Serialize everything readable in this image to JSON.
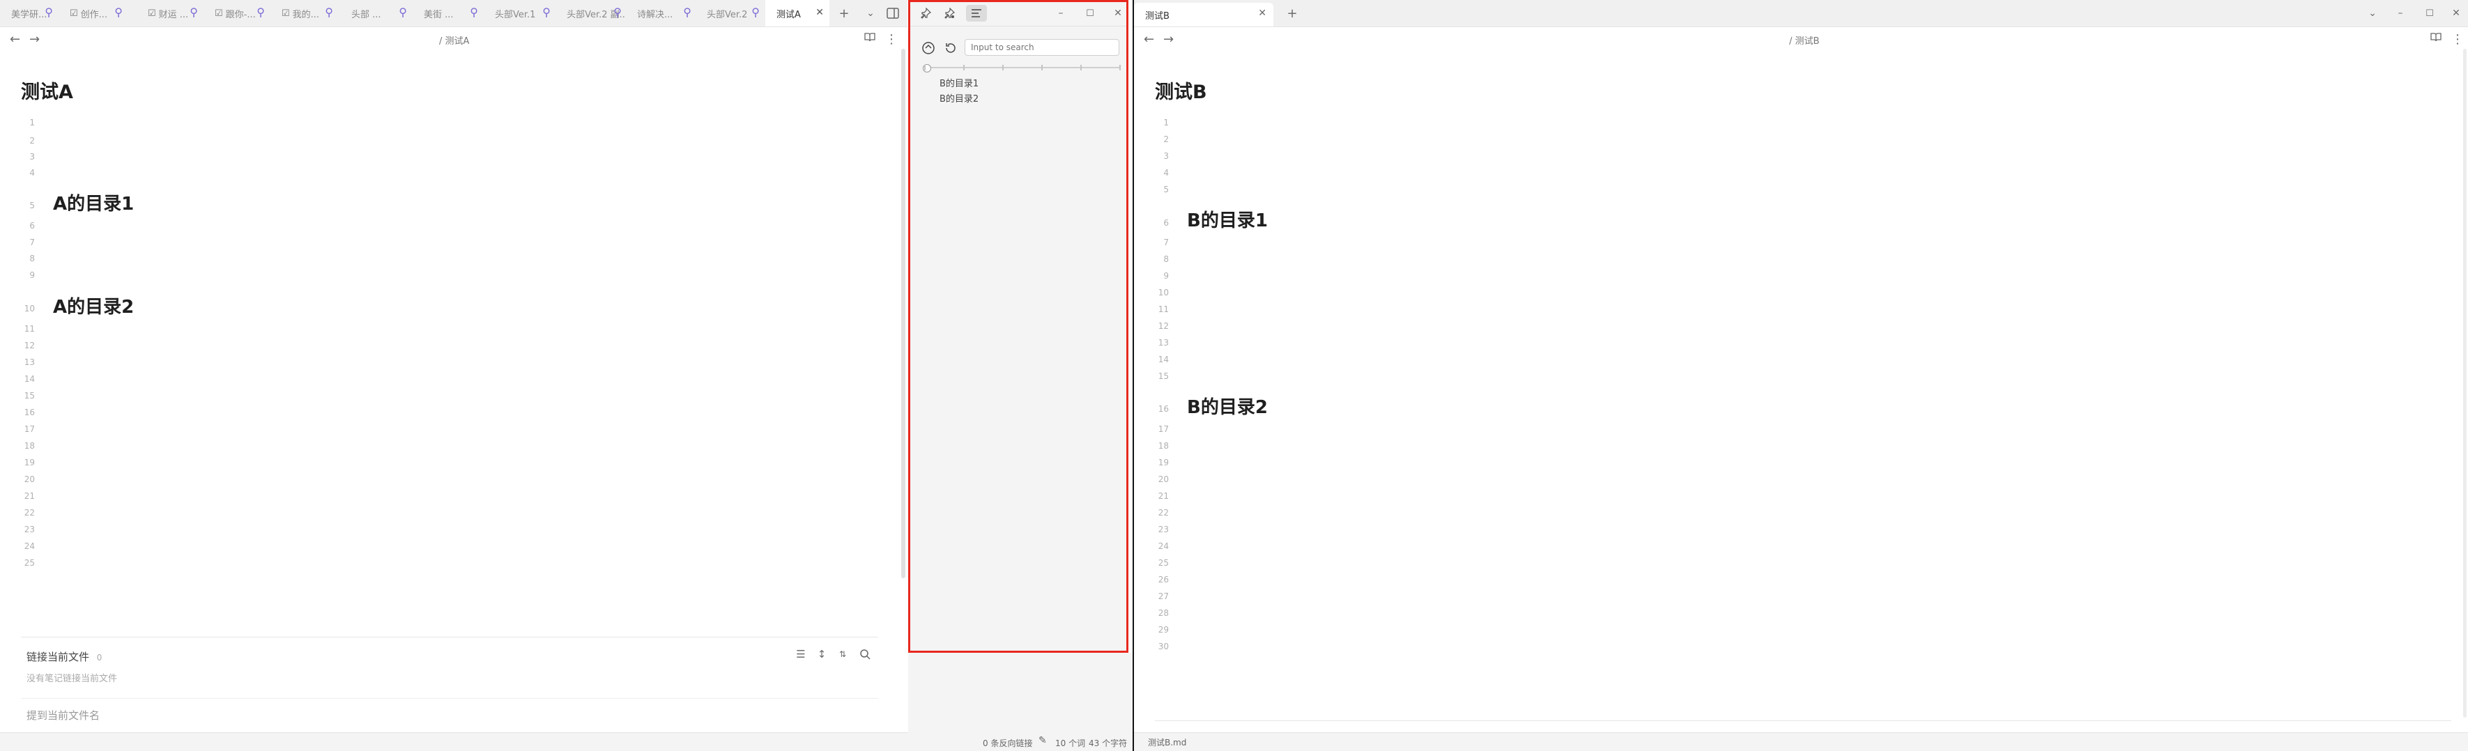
{
  "left_window": {
    "tabs": [
      {
        "label": "美学研...",
        "pinned": true,
        "checkbox": false
      },
      {
        "label": "创作...",
        "pinned": true,
        "checkbox": true
      },
      {
        "label": "财运 ...",
        "pinned": true,
        "checkbox": true
      },
      {
        "label": "跟你-...",
        "pinned": true,
        "checkbox": true
      },
      {
        "label": "我的...",
        "pinned": true,
        "checkbox": true
      },
      {
        "label": "头部 ...",
        "pinned": true,
        "checkbox": false
      },
      {
        "label": "美街 ...",
        "pinned": true,
        "checkbox": false
      },
      {
        "label": "头部Ver.1",
        "pinned": true,
        "checkbox": false
      },
      {
        "label": "头部Ver.2 副...",
        "pinned": true,
        "checkbox": false
      },
      {
        "label": "诗解决...",
        "pinned": true,
        "checkbox": false
      },
      {
        "label": "头部Ver.2",
        "pinned": true,
        "checkbox": false
      },
      {
        "label": "测试A",
        "pinned": false,
        "checkbox": false,
        "active": true
      }
    ],
    "breadcrumb": "/ 测试A",
    "title": "测试A",
    "headings": [
      "A的目录1",
      "A的目录2"
    ],
    "line_numbers": [
      "1",
      "2",
      "3",
      "4",
      "5",
      "6",
      "7",
      "8",
      "9",
      "10",
      "11",
      "12",
      "13",
      "14",
      "15",
      "16",
      "17",
      "18",
      "19",
      "20",
      "21",
      "22",
      "23",
      "24",
      "25"
    ],
    "backlinks": {
      "title": "链接当前文件",
      "count": "0",
      "empty_text": "没有笔记链接当前文件",
      "mentions_title": "提到当前文件名"
    },
    "status": {
      "backlinks": "0 条反向链接",
      "words": "10 个词",
      "chars": "43 个字符"
    }
  },
  "popout": {
    "search_placeholder": "Input to search",
    "outline": [
      "B的目录1",
      "B的目录2"
    ]
  },
  "right_window": {
    "tab_label": "测试B",
    "breadcrumb": "/ 测试B",
    "title": "测试B",
    "headings": [
      "B的目录1",
      "B的目录2"
    ],
    "line_numbers": [
      "1",
      "2",
      "3",
      "4",
      "5",
      "6",
      "7",
      "8",
      "9",
      "10",
      "11",
      "12",
      "13",
      "14",
      "15",
      "16",
      "17",
      "18",
      "19",
      "20",
      "21",
      "22",
      "23",
      "24",
      "25",
      "26",
      "27",
      "28",
      "29",
      "30"
    ],
    "status_file": "测试B.md"
  },
  "colors": {
    "accent_pin": "#7a6bd6",
    "popout_border": "#e8281e"
  }
}
